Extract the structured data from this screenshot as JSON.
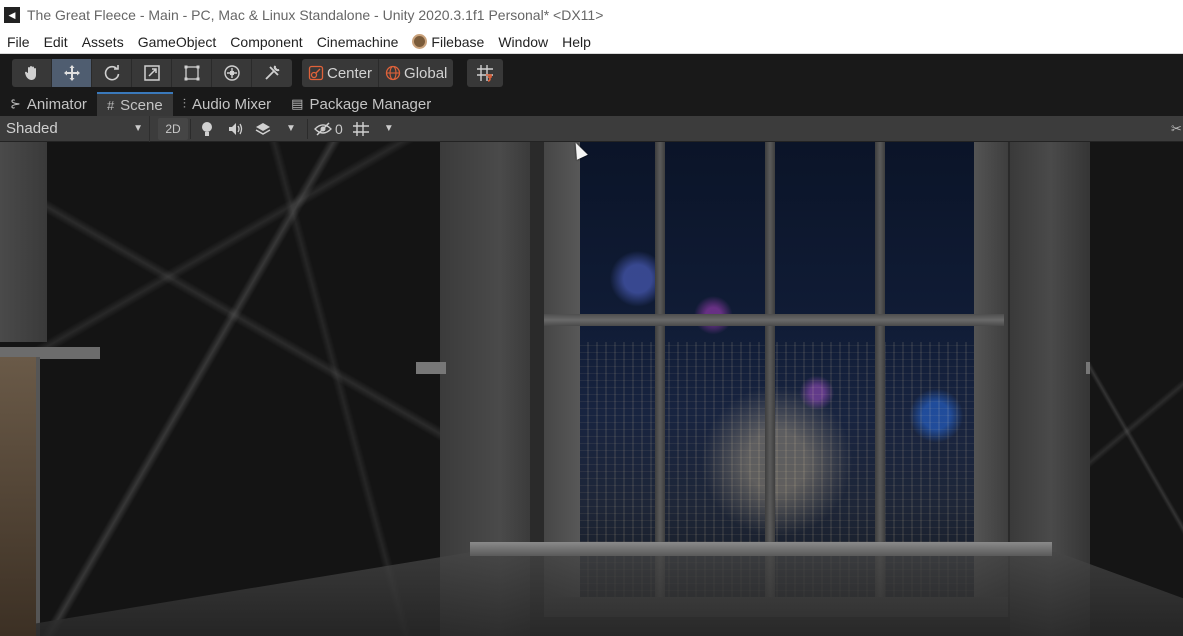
{
  "window": {
    "title": "The Great Fleece - Main - PC, Mac & Linux Standalone - Unity 2020.3.1f1 Personal* <DX11>"
  },
  "menu": {
    "items": [
      "File",
      "Edit",
      "Assets",
      "GameObject",
      "Component",
      "Cinemachine",
      "Filebase",
      "Window",
      "Help"
    ]
  },
  "toolbar": {
    "tools": [
      "hand-tool",
      "move-tool",
      "rotate-tool",
      "scale-tool",
      "rect-tool",
      "transform-tool",
      "custom-tool"
    ],
    "active_tool": "move-tool",
    "pivot_label": "Center",
    "space_label": "Global"
  },
  "tabs": [
    {
      "label": "Animator",
      "icon": "animator-icon"
    },
    {
      "label": "Scene",
      "icon": "scene-icon",
      "active": true
    },
    {
      "label": "Audio Mixer",
      "icon": "audio-mixer-icon"
    },
    {
      "label": "Package Manager",
      "icon": "package-icon"
    }
  ],
  "scene_toolbar": {
    "shading_mode": "Shaded",
    "mode_2d_label": "2D",
    "hidden_count": "0"
  },
  "colors": {
    "active_tab_accent": "#3a79bb",
    "active_tool_bg": "#4f5d70",
    "snap_accent": "#e0623a"
  }
}
